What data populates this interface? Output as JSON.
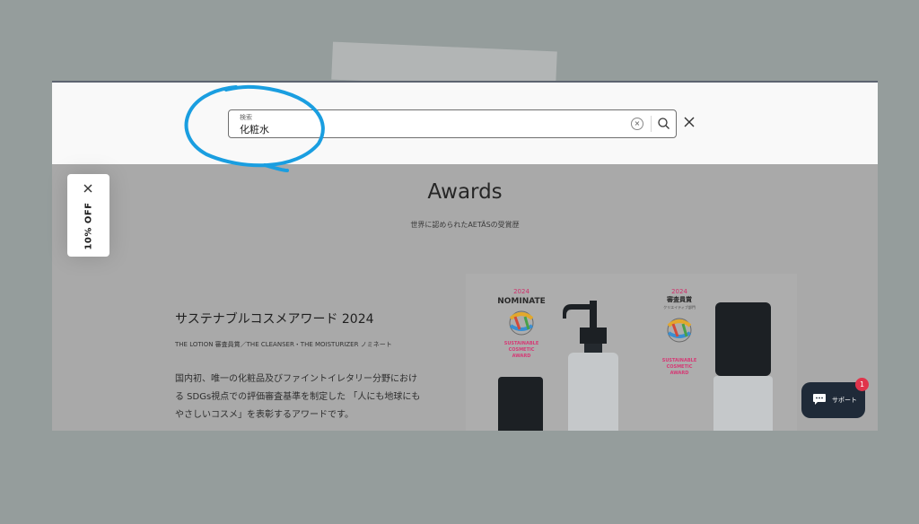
{
  "search": {
    "label": "検索",
    "value": "化粧水",
    "clear_symbol": "×"
  },
  "awards": {
    "title": "Awards",
    "subtitle": "世界に認められたAETÄSの受賞歴"
  },
  "award_item": {
    "heading": "サステナブルコスメアワード 2024",
    "meta": "THE LOTION 審査員賞／THE CLEANSER・THE MOISTURIZER ノミネート",
    "description": "国内初、唯一の化粧品及びファイントイレタリー分野における SDGs視点での評価審査基準を制定した 「人にも地球にもやさしいコスメ」を表彰するアワードです。"
  },
  "product_image": {
    "badge_left": {
      "year": "2024",
      "title": "NOMINATE",
      "line1": "SUSTAINABLE",
      "line2": "COSMETIC",
      "line3": "AWARD"
    },
    "badge_right": {
      "year": "2024",
      "title": "審査員賞",
      "category": "クリエイティブ部門",
      "line1": "SUSTAINABLE",
      "line2": "COSMETIC",
      "line3": "AWARD"
    }
  },
  "promo": {
    "discount_label": "10% OFF"
  },
  "support": {
    "label": "サポート",
    "unread_count": "1"
  },
  "colors": {
    "background": "#959d9c",
    "annotation_stroke": "#1a9ee0",
    "support_bg": "#1f2a38",
    "badge_red": "#e0344b"
  }
}
